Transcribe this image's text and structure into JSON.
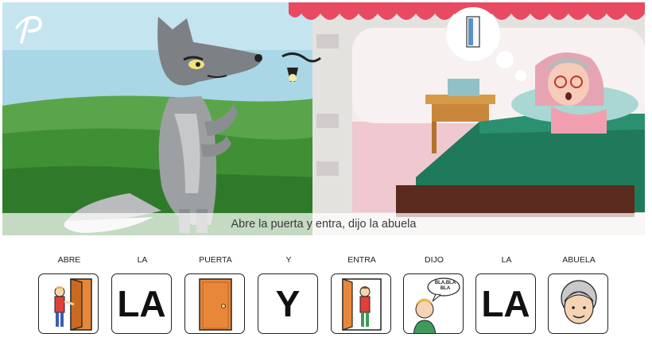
{
  "logo": {
    "letter": "P"
  },
  "caption": "Abre la puerta y entra, dijo la abuela",
  "pictograms": [
    {
      "label": "ABRE",
      "icon": "person-opening-door-icon"
    },
    {
      "label": "LA",
      "word": "LA"
    },
    {
      "label": "PUERTA",
      "icon": "door-icon"
    },
    {
      "label": "Y",
      "word": "Y"
    },
    {
      "label": "ENTRA",
      "icon": "person-entering-door-icon"
    },
    {
      "label": "DIJO",
      "icon": "boy-speaking-icon",
      "speech": "BLA,BLA BLA"
    },
    {
      "label": "LA",
      "word": "LA"
    },
    {
      "label": "ABUELA",
      "icon": "grandmother-face-icon"
    }
  ],
  "colors": {
    "door": "#e8873a",
    "sky": "#a9d7e6",
    "grass": "#3f8f35",
    "bed": "#1e7a5b"
  }
}
